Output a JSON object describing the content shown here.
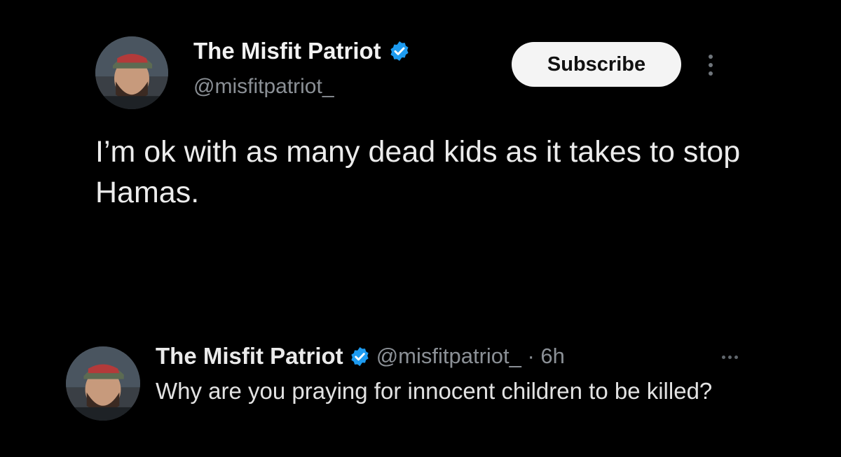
{
  "tweet": {
    "author": {
      "name": "The Misfit Patriot",
      "handle": "@misfitpatriot_",
      "verified_icon": "verified-badge-icon",
      "avatar_icon": "avatar-photo"
    },
    "subscribe_label": "Subscribe",
    "more_icon": "more-vertical-icon",
    "text": "I’m ok with as many dead kids as it takes to stop Hamas."
  },
  "reply": {
    "author": {
      "name": "The Misfit Patriot",
      "handle_time": "@misfitpatriot_ · 6h",
      "verified_icon": "verified-badge-icon",
      "avatar_icon": "avatar-photo"
    },
    "more_icon": "more-horizontal-icon",
    "text": "Why are you praying for innocent children to be killed?"
  },
  "colors": {
    "background": "#000000",
    "verified_blue": "#1d9bf0",
    "secondary_text": "#8b9096",
    "button_bg": "#f4f4f4"
  }
}
